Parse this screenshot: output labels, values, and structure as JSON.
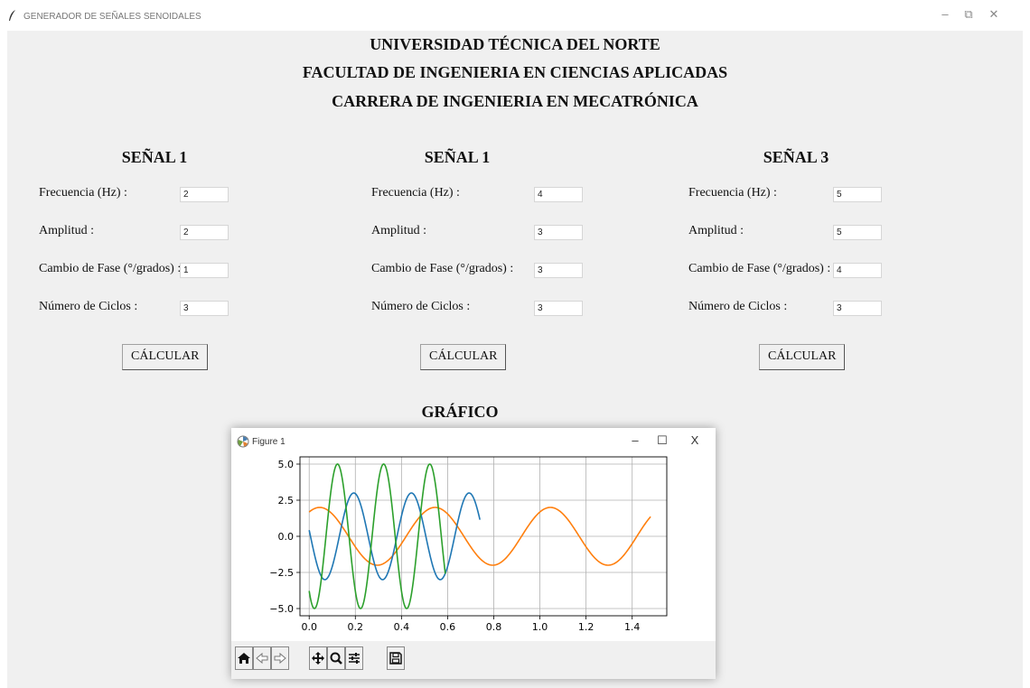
{
  "window": {
    "title": "GENERADOR DE SEÑALES SENOIDALES"
  },
  "header": {
    "line1": "UNIVERSIDAD TÉCNICA DEL NORTE",
    "line2": "FACULTAD DE INGENIERIA EN CIENCIAS APLICADAS",
    "line3": "CARRERA DE INGENIERIA EN MECATRÓNICA"
  },
  "signals": [
    {
      "title": "SEÑAL 1",
      "frequency_label": "Frecuencia (Hz) :",
      "frequency_value": "2",
      "amplitude_label": "Amplitud :",
      "amplitude_value": "2",
      "phase_label": "Cambio de Fase (°/grados) :",
      "phase_value": "1",
      "cycles_label": "Número de Ciclos :",
      "cycles_value": "3",
      "button_label": "CÁLCULAR"
    },
    {
      "title": "SEÑAL 1",
      "frequency_label": "Frecuencia (Hz) :",
      "frequency_value": "4",
      "amplitude_label": "Amplitud :",
      "amplitude_value": "3",
      "phase_label": "Cambio de Fase (°/grados) :",
      "phase_value": "3",
      "cycles_label": "Número de Ciclos :",
      "cycles_value": "3",
      "button_label": "CÁLCULAR"
    },
    {
      "title": "SEÑAL 3",
      "frequency_label": "Frecuencia (Hz) :",
      "frequency_value": "5",
      "amplitude_label": "Amplitud :",
      "amplitude_value": "5",
      "phase_label": "Cambio de Fase (°/grados) :",
      "phase_value": "4",
      "cycles_label": "Número de Ciclos :",
      "cycles_value": "3",
      "button_label": "CÁLCULAR"
    }
  ],
  "graph_title": "GRÁFICO",
  "figure": {
    "title": "Figure 1",
    "controls": {
      "minimize": "–",
      "maximize": "☐",
      "close": "X"
    }
  },
  "toolbar": {
    "icons": [
      "home-icon",
      "back-icon",
      "forward-icon",
      "pan-icon",
      "zoom-icon",
      "configure-icon",
      "save-icon"
    ]
  },
  "colors": {
    "blue": "#1f77b4",
    "orange": "#ff7f0e",
    "green": "#2ca02c"
  },
  "chart_data": {
    "type": "line",
    "title": "",
    "xlabel": "",
    "ylabel": "",
    "xlim": [
      -0.04,
      1.55
    ],
    "ylim": [
      -5.5,
      5.5
    ],
    "grid": true,
    "xticks": [
      "0.0",
      "0.2",
      "0.4",
      "0.6",
      "0.8",
      "1.0",
      "1.2",
      "1.4"
    ],
    "yticks": [
      "5.0",
      "2.5",
      "0.0",
      "−2.5",
      "−5.0"
    ],
    "xtick_values": [
      0.0,
      0.2,
      0.4,
      0.6,
      0.8,
      1.0,
      1.2,
      1.4
    ],
    "ytick_values": [
      5.0,
      2.5,
      0.0,
      -2.5,
      -5.0
    ],
    "series": [
      {
        "color": "#ff7f0e",
        "frequency": 2,
        "amplitude": 2,
        "phase_deg": 1,
        "x_range": [
          0,
          1.48
        ]
      },
      {
        "color": "#1f77b4",
        "frequency": 4,
        "amplitude": 3,
        "phase_deg": 3,
        "x_range": [
          0,
          0.74
        ]
      },
      {
        "color": "#2ca02c",
        "frequency": 5,
        "amplitude": 5,
        "phase_deg": 4,
        "x_range": [
          0,
          0.59
        ]
      }
    ]
  }
}
